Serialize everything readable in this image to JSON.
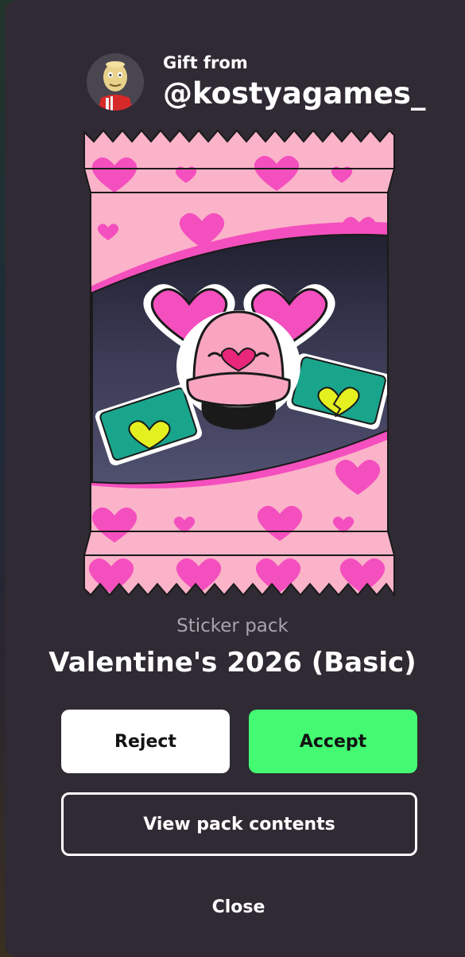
{
  "gift": {
    "from_label": "Gift from",
    "username": "@kostyagames_"
  },
  "pack": {
    "type": "Sticker pack",
    "name": "Valentine's 2026 (Basic)",
    "art_icon": "valentine-sticker-pack-art"
  },
  "actions": {
    "reject_label": "Reject",
    "accept_label": "Accept",
    "view_contents_label": "View pack contents",
    "close_label": "Close"
  },
  "colors": {
    "sheet_background": "#2f2a33",
    "accept_green": "#44fa72",
    "reject_white": "#ffffff",
    "pack_pink": "#fbb3c9",
    "heart_pink": "#f44fbe"
  }
}
